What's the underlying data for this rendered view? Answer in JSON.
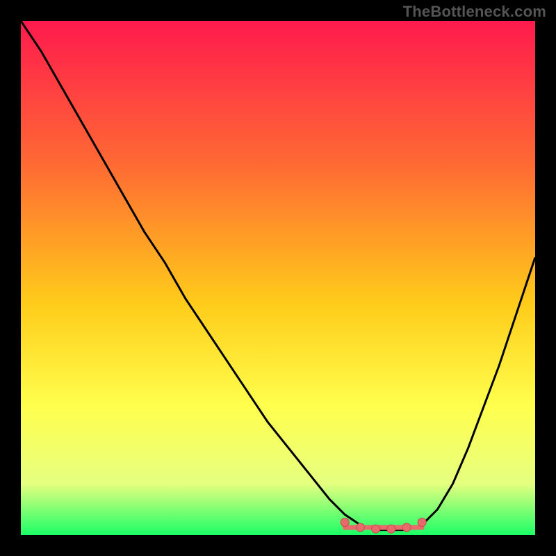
{
  "watermark": "TheBottleneck.com",
  "colors": {
    "background": "#000000",
    "gradient_top": "#ff1a4d",
    "gradient_mid1": "#ff6a33",
    "gradient_mid2": "#ffcc1a",
    "gradient_mid3": "#ffff4d",
    "gradient_mid4": "#e6ff80",
    "gradient_bottom": "#1aff66",
    "curve": "#000000",
    "marker_fill": "#e86a6a",
    "marker_stroke": "#c74a4a"
  },
  "chart_data": {
    "type": "line",
    "title": "",
    "xlabel": "",
    "ylabel": "",
    "xlim": [
      0,
      100
    ],
    "ylim": [
      0,
      100
    ],
    "curve": {
      "x": [
        0,
        4,
        8,
        12,
        16,
        20,
        24,
        28,
        32,
        36,
        40,
        44,
        48,
        52,
        56,
        60,
        63,
        66,
        69,
        72,
        75,
        78,
        81,
        84,
        87,
        90,
        93,
        96,
        100
      ],
      "y": [
        100,
        94,
        87,
        80,
        73,
        66,
        59,
        53,
        46,
        40,
        34,
        28,
        22,
        17,
        12,
        7,
        4,
        2,
        1,
        1,
        1,
        2,
        5,
        10,
        17,
        25,
        33,
        42,
        54
      ]
    },
    "flat_region": {
      "x_start": 63,
      "x_end": 78,
      "y": 1.5
    },
    "markers": [
      {
        "x": 63,
        "y": 2.5
      },
      {
        "x": 66,
        "y": 1.5
      },
      {
        "x": 69,
        "y": 1.2
      },
      {
        "x": 72,
        "y": 1.2
      },
      {
        "x": 75,
        "y": 1.5
      },
      {
        "x": 78,
        "y": 2.5
      }
    ]
  }
}
